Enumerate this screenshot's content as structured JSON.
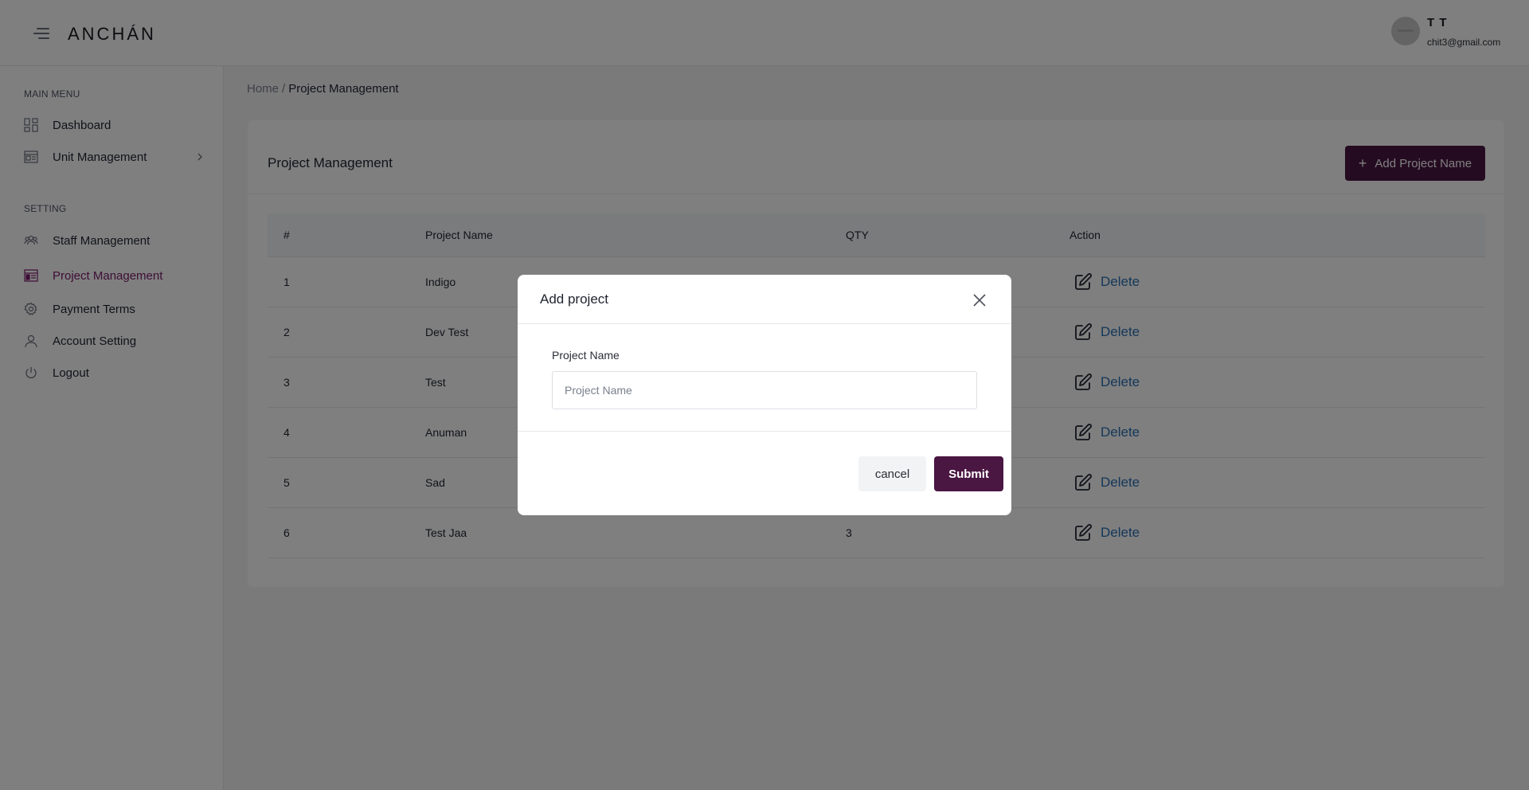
{
  "header": {
    "logo": "ANCHÁN",
    "user_name": "T T",
    "user_email": "chit3@gmail.com"
  },
  "sidebar": {
    "main_menu_label": "MAIN MENU",
    "setting_label": "SETTING",
    "main_items": [
      {
        "label": "Dashboard",
        "icon": "dashboard-icon"
      },
      {
        "label": "Unit Management",
        "icon": "unit-icon",
        "has_submenu": true
      }
    ],
    "setting_items": [
      {
        "label": "Staff Management",
        "icon": "users-icon"
      },
      {
        "label": "Project Management",
        "icon": "project-icon",
        "active": true
      },
      {
        "label": "Payment Terms",
        "icon": "gear-icon"
      },
      {
        "label": "Account Setting",
        "icon": "user-icon"
      },
      {
        "label": "Logout",
        "icon": "power-icon"
      }
    ]
  },
  "breadcrumb": {
    "home": "Home",
    "separator": "/",
    "current": "Project Management"
  },
  "card": {
    "title": "Project Management",
    "add_button_icon": "+",
    "add_button_label": "Add Project Name"
  },
  "table": {
    "headers": [
      "#",
      "Project Name",
      "QTY",
      "Action"
    ],
    "rows": [
      {
        "num": "1",
        "name": "Indigo",
        "qty": "",
        "action": "Delete"
      },
      {
        "num": "2",
        "name": "Dev Test",
        "qty": "",
        "action": "Delete"
      },
      {
        "num": "3",
        "name": "Test",
        "qty": "",
        "action": "Delete"
      },
      {
        "num": "4",
        "name": "Anuman",
        "qty": "",
        "action": "Delete"
      },
      {
        "num": "5",
        "name": "Sad",
        "qty": "",
        "action": "Delete"
      },
      {
        "num": "6",
        "name": "Test Jaa",
        "qty": "3",
        "action": "Delete"
      }
    ]
  },
  "modal": {
    "title": "Add project",
    "field_label": "Project Name",
    "field_value": "",
    "field_placeholder": "Project Name",
    "cancel_label": "cancel",
    "submit_label": "Submit"
  },
  "colors": {
    "brand": "#4a1642",
    "active_nav": "#7a1a6b",
    "link": "#2a6fb3"
  }
}
